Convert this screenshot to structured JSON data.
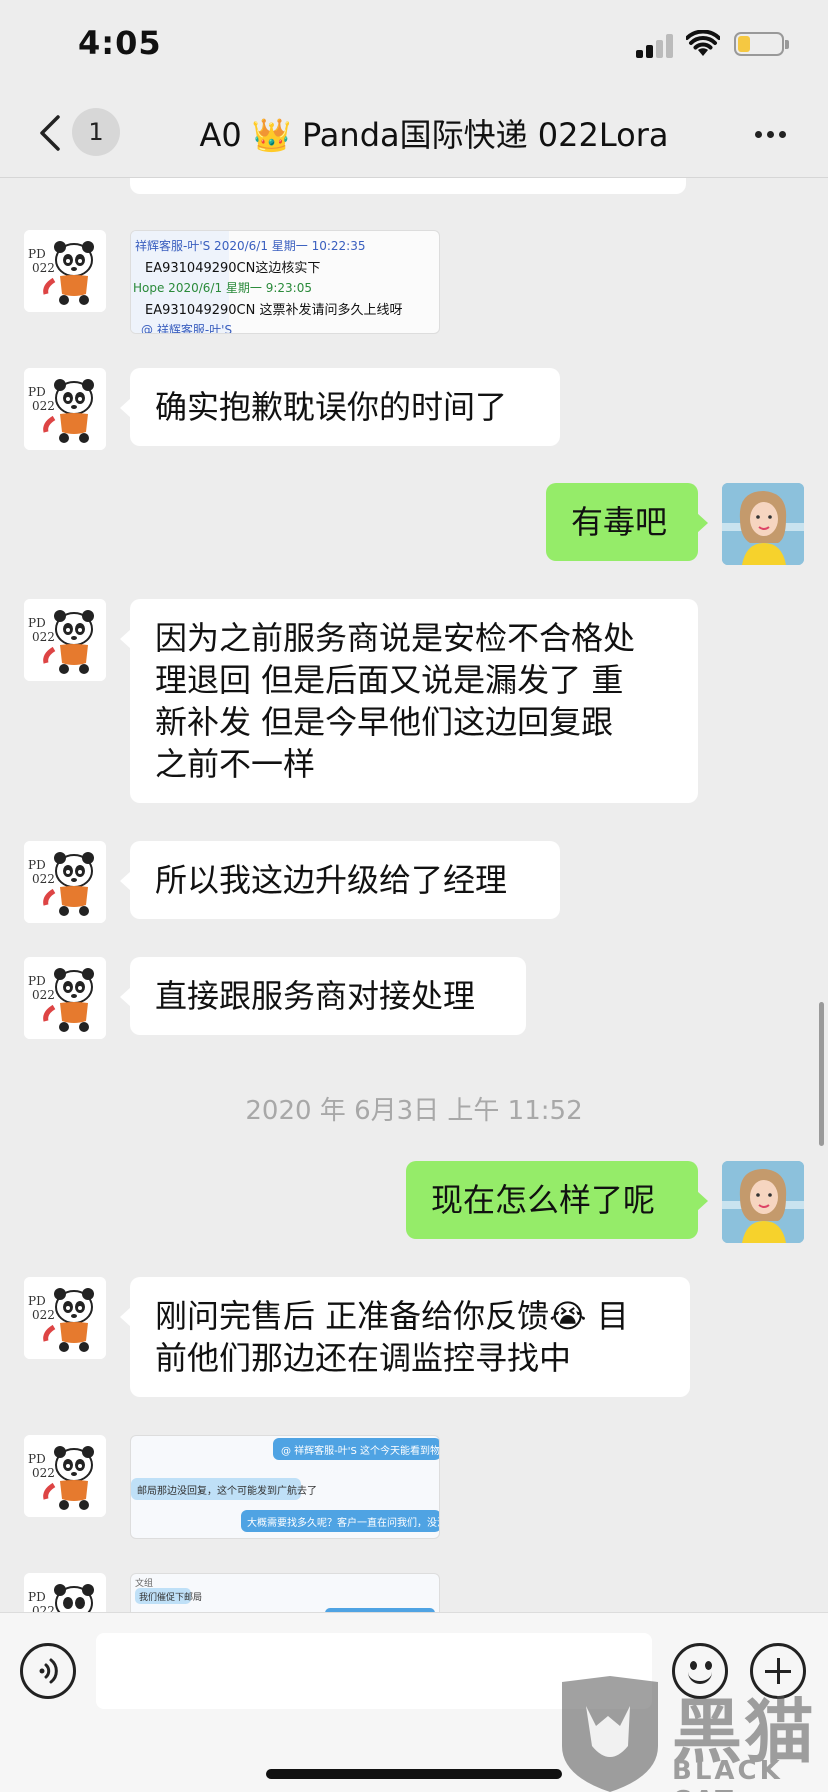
{
  "status_bar": {
    "time": "4:05"
  },
  "nav": {
    "unread_count": "1",
    "title": "A0 👑 Panda国际快递 022Lora"
  },
  "avatars": {
    "panda_label": "PD\n022"
  },
  "screenshot_1": {
    "lines": [
      "祥辉客服-叶'S 2020/6/1 星期一 10:22:35",
      "EA931049290CN这边核实下",
      "Hope 2020/6/1 星期一 9:23:05",
      "EA931049290CN 这票补发请问多久上线呀",
      "@ 祥辉客服-叶'S"
    ]
  },
  "messages": {
    "m1": "确实抱歉耽误你的时间了",
    "m2": "有毒吧",
    "m3": "因为之前服务商说是安检不合格处\n理退回 但是后面又说是漏发了 重\n新补发 但是今早他们这边回复跟\n之前不一样",
    "m4": "所以我这边升级给了经理",
    "m5": "直接跟服务商对接处理",
    "m6": "现在怎么样了呢",
    "m7": "刚问完售后 正准备给你反馈😭 目\n前他们那边还在调监控寻找中"
  },
  "timestamp": "2020 年 6月3日 上午 11:52",
  "screenshot_2": {
    "lines": [
      "@ 祥辉客服-叶'S 这个今天能看到物品吗",
      "邮局那边没回复，这个可能发到广航去了",
      "大概需要找多久呢？客户一直在问我们，没法给客户"
    ]
  },
  "screenshot_3": {
    "lines": [
      "文组",
      "我们催促下邮局"
    ]
  },
  "input": {
    "placeholder": ""
  },
  "watermark": {
    "cn": "黑猫",
    "en": "BLACK CAT"
  },
  "colors": {
    "outgoing_bubble": "#95ec69",
    "incoming_bubble": "#ffffff",
    "background": "#ededed"
  }
}
